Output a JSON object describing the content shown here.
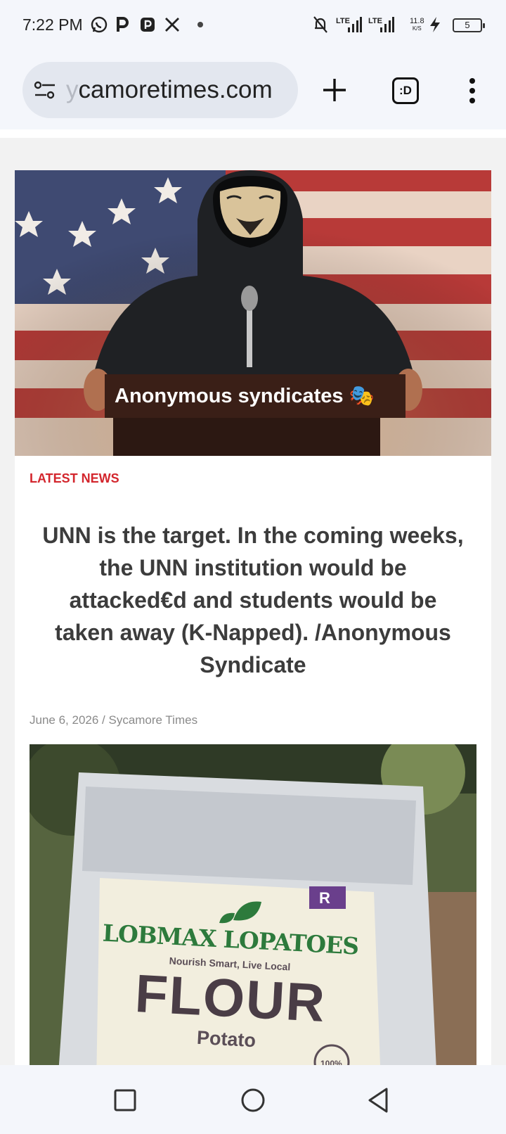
{
  "status_bar": {
    "time": "7:22 PM",
    "icons": [
      "whatsapp-icon",
      "p-icon",
      "p-badge-icon",
      "x-icon",
      "dot-icon",
      "bell-off-icon",
      "signal-icon",
      "signal-icon",
      "charging-icon"
    ],
    "lte1": "LTE",
    "lte2": "LTE",
    "speed_value": "11.8",
    "speed_unit": "K/S",
    "battery": "5"
  },
  "browser": {
    "url_faded": "y",
    "url": "camoretimes.com",
    "tabs_label": ":D"
  },
  "article": {
    "hero_caption": "Anonymous syndicates 🎭",
    "kicker": "LATEST NEWS",
    "headline": "UNN is the target. In the coming weeks, the UNN institution would be attacked€d and students would be taken away (K-Napped). /Anonymous Syndicate",
    "meta": "June 6, 2026 / Sycamore Times"
  },
  "photo": {
    "brand": "LOBMAX LOPATOES",
    "tagline": "Nourish Smart, Live Local",
    "product": "FLOUR",
    "variant": "Potato",
    "badge": "100%",
    "mark": "R"
  },
  "colors": {
    "accent_red": "#d3262d",
    "flour_green": "#2d7a3c"
  }
}
